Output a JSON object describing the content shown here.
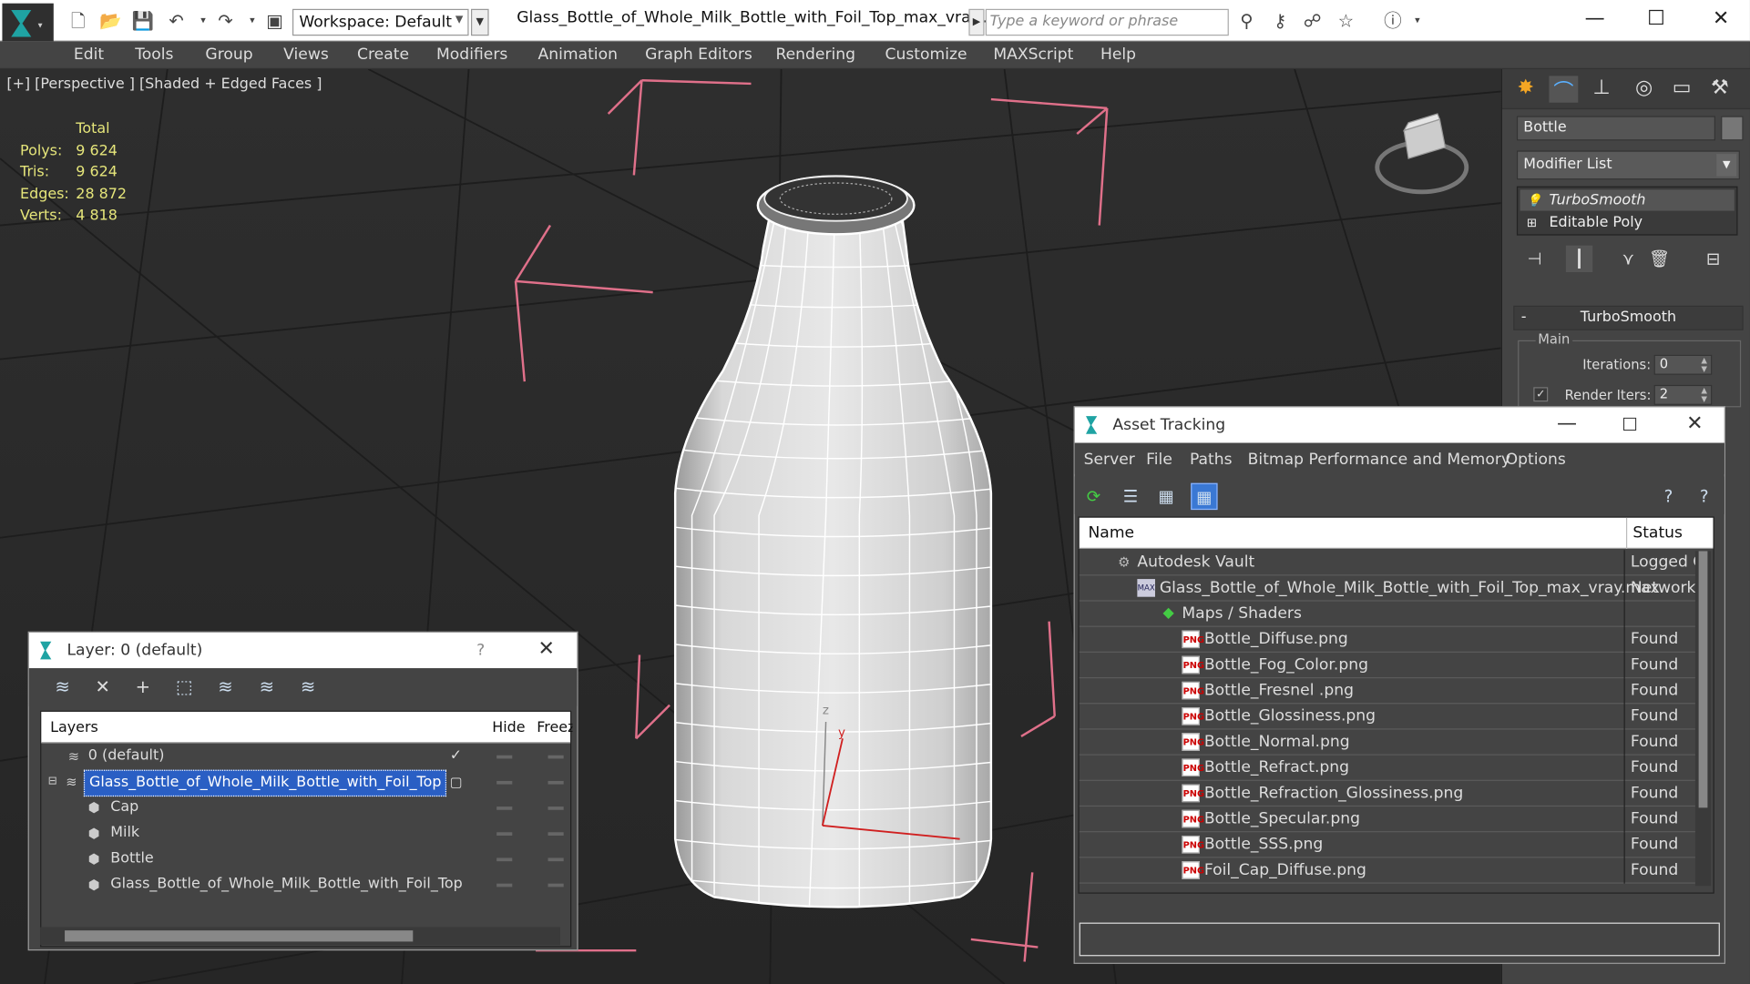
{
  "window": {
    "workspace": "Workspace: Default",
    "file_title": "Glass_Bottle_of_Whole_Milk_Bottle_with_Foil_Top_max_vray....",
    "search_placeholder": "Type a keyword or phrase"
  },
  "menu": [
    "Edit",
    "Tools",
    "Group",
    "Views",
    "Create",
    "Modifiers",
    "Animation",
    "Graph Editors",
    "Rendering",
    "Customize",
    "MAXScript",
    "Help"
  ],
  "viewport": {
    "label": "[+] [Perspective ] [Shaded + Edged Faces ]",
    "stats_header": "Total",
    "stats": [
      {
        "key": "Polys:",
        "value": "9 624"
      },
      {
        "key": "Tris:",
        "value": "9 624"
      },
      {
        "key": "Edges:",
        "value": "28 872"
      },
      {
        "key": "Verts:",
        "value": "4 818"
      }
    ],
    "gizmo_axes": {
      "z": "z",
      "y": "y"
    }
  },
  "command_panel": {
    "object_name": "Bottle",
    "modifier_list": "Modifier List",
    "stack": [
      "TurboSmooth",
      "Editable Poly"
    ],
    "rollout_title": "TurboSmooth",
    "group_main": "Main",
    "iterations_label": "Iterations:",
    "iterations_value": "0",
    "render_iters_label": "Render Iters:",
    "render_iters_value": "2",
    "render_iters_checked": true
  },
  "layer_window": {
    "title": "Layer: 0 (default)",
    "help": "?",
    "columns": {
      "layers": "Layers",
      "hide": "Hide",
      "freeze": "Freeze"
    },
    "rows": [
      {
        "name": "0 (default)",
        "indent": 0,
        "current": true
      },
      {
        "name": "Glass_Bottle_of_Whole_Milk_Bottle_with_Foil_Top",
        "indent": 0,
        "selected": true
      },
      {
        "name": "Cap",
        "indent": 1
      },
      {
        "name": "Milk",
        "indent": 1
      },
      {
        "name": "Bottle",
        "indent": 1
      },
      {
        "name": "Glass_Bottle_of_Whole_Milk_Bottle_with_Foil_Top",
        "indent": 1
      }
    ]
  },
  "asset_window": {
    "title": "Asset Tracking",
    "menu": [
      "Server",
      "File",
      "Paths",
      "Bitmap Performance and Memory",
      "Options"
    ],
    "columns": {
      "name": "Name",
      "status": "Status"
    },
    "rows": [
      {
        "name": "Autodesk Vault",
        "status": "Logged O",
        "indent": 1,
        "icon": "vault"
      },
      {
        "name": "Glass_Bottle_of_Whole_Milk_Bottle_with_Foil_Top_max_vray.max",
        "status": "Network",
        "indent": 2,
        "icon": "max"
      },
      {
        "name": "Maps / Shaders",
        "status": "",
        "indent": 3,
        "icon": "maps"
      },
      {
        "name": "Bottle_Diffuse.png",
        "status": "Found",
        "indent": 4,
        "icon": "png"
      },
      {
        "name": "Bottle_Fog_Color.png",
        "status": "Found",
        "indent": 4,
        "icon": "png"
      },
      {
        "name": "Bottle_Fresnel .png",
        "status": "Found",
        "indent": 4,
        "icon": "png"
      },
      {
        "name": "Bottle_Glossiness.png",
        "status": "Found",
        "indent": 4,
        "icon": "png"
      },
      {
        "name": "Bottle_Normal.png",
        "status": "Found",
        "indent": 4,
        "icon": "png"
      },
      {
        "name": "Bottle_Refract.png",
        "status": "Found",
        "indent": 4,
        "icon": "png"
      },
      {
        "name": "Bottle_Refraction_Glossiness.png",
        "status": "Found",
        "indent": 4,
        "icon": "png"
      },
      {
        "name": "Bottle_Specular.png",
        "status": "Found",
        "indent": 4,
        "icon": "png"
      },
      {
        "name": "Bottle_SSS.png",
        "status": "Found",
        "indent": 4,
        "icon": "png"
      },
      {
        "name": "Foil_Cap_Diffuse.png",
        "status": "Found",
        "indent": 4,
        "icon": "png"
      }
    ]
  },
  "colors": {
    "selection": "#2a5fc4",
    "stats": "#e5e57a",
    "bbox": "#e0708a"
  }
}
